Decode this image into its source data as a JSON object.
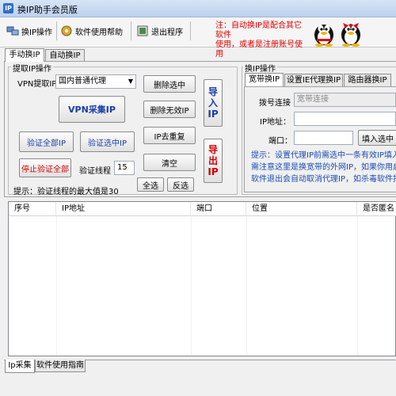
{
  "window": {
    "title": "换IP助手会员版"
  },
  "toolbar": {
    "items": [
      {
        "label": "换IP操作",
        "icon": "network-icon"
      },
      {
        "label": "软件使用帮助",
        "icon": "help-gear-icon"
      },
      {
        "label": "退出程序",
        "icon": "exit-icon"
      }
    ],
    "notice_line1": "注：自动换IP是配合其它软件",
    "notice_line2": "使用，或者是注册账号使用"
  },
  "main_tabs": [
    "手动换IP",
    "自动换IP"
  ],
  "extract_panel": {
    "title": "提取IP操作",
    "vpn_label": "VPN提取IP",
    "vpn_select_value": "国内普通代理",
    "vpn_collect_button": "VPN采集IP",
    "delete_selected_button": "删除选中",
    "delete_invalid_button": "删除无效IP",
    "dedupe_button": "IP去重复",
    "clear_button": "清空",
    "verify_all_button": "验证全部IP",
    "verify_selected_button": "验证选中IP",
    "stop_verify_button": "停止验证全部",
    "threads_label": "验证线程",
    "threads_value": "15",
    "select_all_button": "全选",
    "invert_button": "反选",
    "import_button": "导入IP",
    "export_button": "导出IP",
    "hint": "提示：验证线程的最大值是30"
  },
  "switch_panel": {
    "title": "换IP操作",
    "tabs": [
      "宽带换IP",
      "设置IE代理换IP",
      "路由器换IP"
    ],
    "dial_label": "拨号连接",
    "dial_value": "宽带连接",
    "ip_label": "IP地址：",
    "ip_value": "",
    "port_label": "端口：",
    "port_value": "",
    "fill_button": "填入选中",
    "tip_lines": [
      "提示：设置代理IP前需选中一条有效IP填入",
      "需注意这里是换宽带的外网IP，如果你用启",
      "软件退出会自动取消代理IP，如杀毒软件拦"
    ]
  },
  "table": {
    "columns": [
      "序号",
      "IP地址",
      "端口",
      "位置",
      "是否匿名"
    ],
    "rows": []
  },
  "bottom_tabs": [
    "Ip采集",
    "软件使用指南"
  ]
}
